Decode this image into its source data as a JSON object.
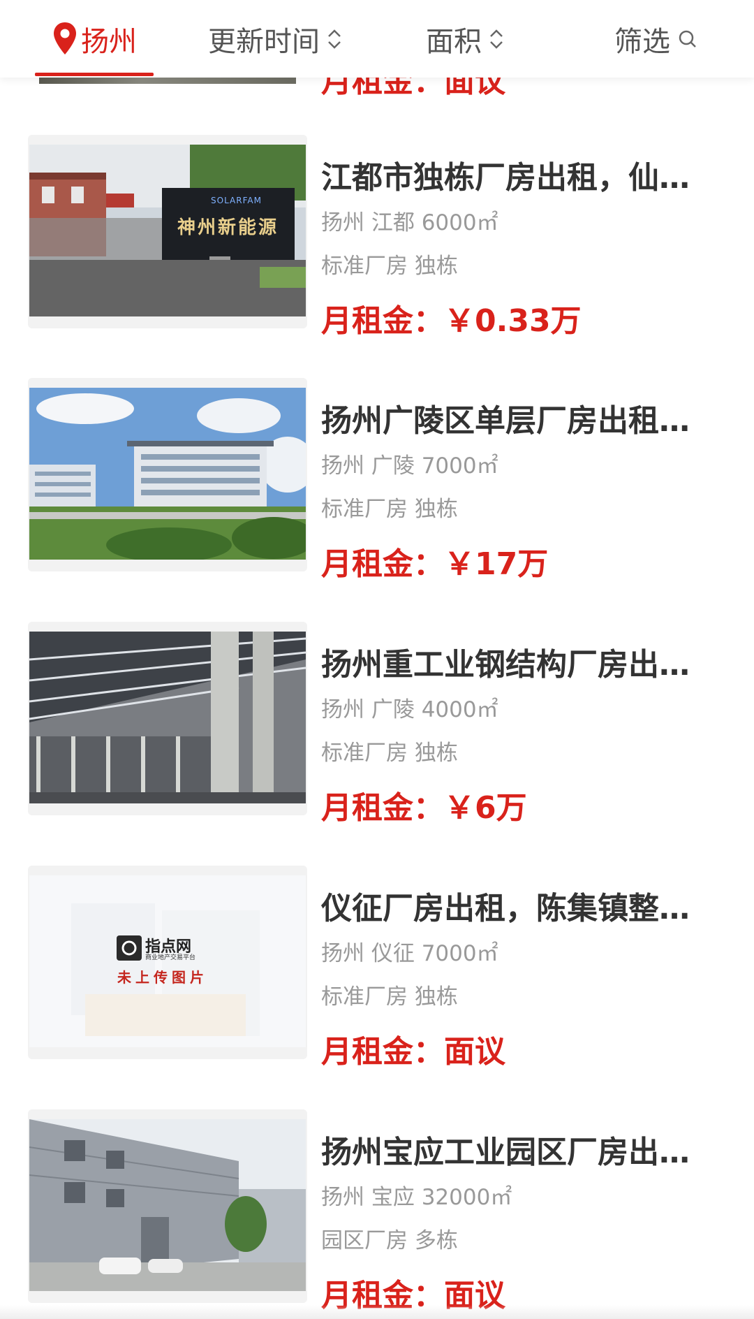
{
  "filter_bar": {
    "city": "扬州",
    "sort_update": "更新时间",
    "sort_area": "面积",
    "filter": "筛选"
  },
  "peek": {
    "price": "月租金：面议"
  },
  "price_prefix": "月租金：",
  "listings": [
    {
      "title": "江都市独栋厂房出租，仙…",
      "meta": "扬州 江都 6000㎡",
      "tags": "标准厂房 独栋",
      "price": "月租金：￥0.33万",
      "image_text": [
        "SOLARFAM",
        "神州新能源"
      ]
    },
    {
      "title": "扬州广陵区单层厂房出租…",
      "meta": "扬州 广陵 7000㎡",
      "tags": "标准厂房 独栋",
      "price": "月租金：￥17万"
    },
    {
      "title": "扬州重工业钢结构厂房出…",
      "meta": "扬州 广陵 4000㎡",
      "tags": "标准厂房 独栋",
      "price": "月租金：￥6万"
    },
    {
      "title": "仪征厂房出租，陈集镇整…",
      "meta": "扬州 仪征 7000㎡",
      "tags": "标准厂房 独栋",
      "price": "月租金：面议",
      "image_text": [
        "指点网",
        "商业地产交易平台",
        "未上传图片"
      ]
    },
    {
      "title": "扬州宝应工业园区厂房出…",
      "meta": "扬州 宝应 32000㎡",
      "tags": "园区厂房 多栋",
      "price": "月租金：面议"
    }
  ],
  "colors": {
    "accent": "#d9221b",
    "title": "#333333",
    "meta": "#999999"
  }
}
